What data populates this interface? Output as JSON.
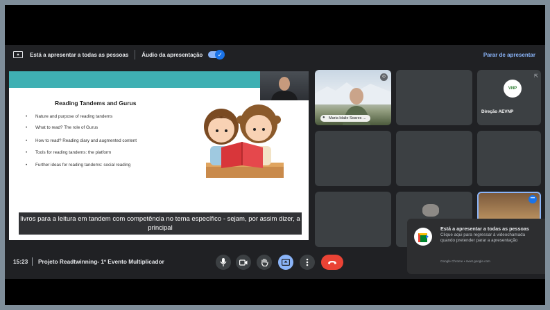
{
  "banner": {
    "presenting_text": "Está a apresentar a todas as pessoas",
    "audio_text": "Áudio da apresentação",
    "audio_toggle_on": true,
    "stop_text": "Parar de apresentar"
  },
  "slide": {
    "title": "Reading Tandems and Gurus",
    "bullets": [
      "Nature and purpose of reading tandems",
      "What to read? The role of Gurus",
      "How to read? Reading diary and augmented content",
      "Tools for reading tandems: the platform",
      "Further ideas for reading tandems: social reading"
    ],
    "caption": "livros para a leitura em tandem com competência no tema específico - sejam, por assim dizer, a principal"
  },
  "participants": {
    "maria": "Maria Idalie Soares ...",
    "direcao": "Direção AEVNP",
    "direcao_logo": "VNP"
  },
  "notification": {
    "title": "Está a apresentar a todas as pessoas",
    "body": "Clique aqui para regressar à videochamada quando pretender parar a apresentação",
    "source": "Google Chrome • meet.google.com"
  },
  "bottom_bar": {
    "time": "15:23",
    "meeting_name": "Projeto Readtwinning- 1º Evento Multiplicador"
  },
  "colors": {
    "meet_background": "#202124",
    "tile": "#3c4043",
    "accent_blue": "#8ab4f8",
    "leave_red": "#ea4335",
    "slide_teal": "#3fb0b3"
  },
  "icons": [
    "present-screen-icon",
    "mic-icon",
    "camera-icon",
    "raise-hand-icon",
    "present-now-icon",
    "more-options-icon",
    "end-call-icon",
    "google-meet-icon",
    "pin-icon"
  ]
}
